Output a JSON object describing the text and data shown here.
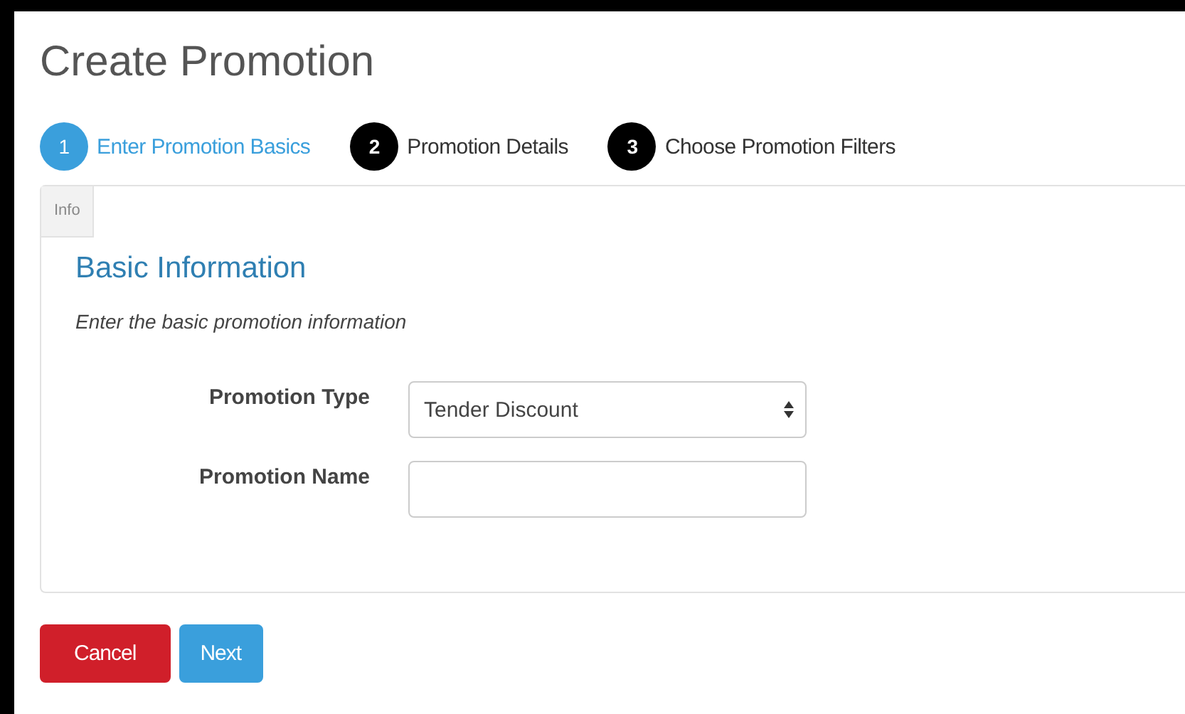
{
  "page": {
    "title": "Create Promotion"
  },
  "steps": [
    {
      "number": "1",
      "label": "Enter Promotion Basics",
      "selected": true
    },
    {
      "number": "2",
      "label": "Promotion Details",
      "selected": false
    },
    {
      "number": "3",
      "label": "Choose Promotion Filters",
      "selected": false
    }
  ],
  "panel": {
    "tab": "Info",
    "heading": "Basic Information",
    "description": "Enter the basic promotion information",
    "fields": [
      {
        "kind": "select",
        "label": "Promotion Type",
        "value": "Tender Discount"
      },
      {
        "kind": "text",
        "label": "Promotion Name"
      }
    ]
  },
  "buttons": [
    {
      "kind": "danger",
      "label": "Cancel"
    },
    {
      "kind": "primary",
      "label": "Next"
    }
  ]
}
